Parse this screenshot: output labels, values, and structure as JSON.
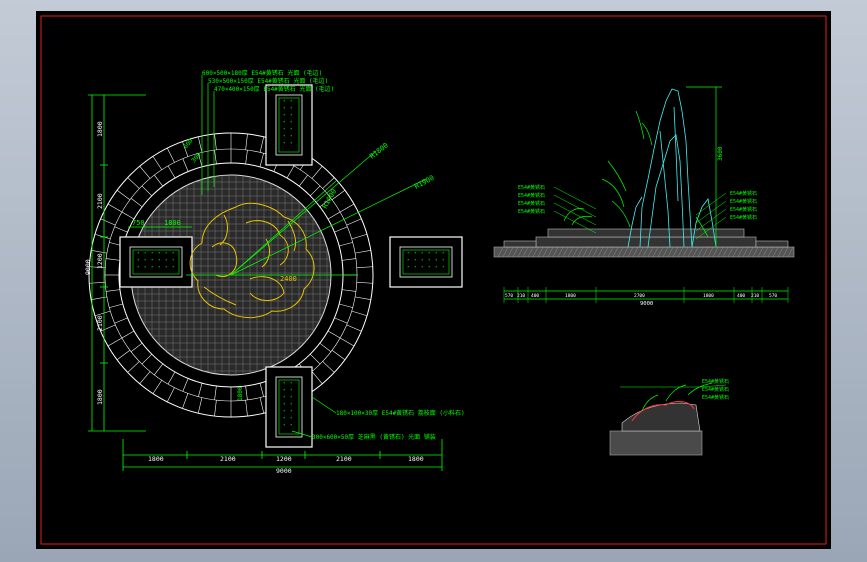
{
  "plan": {
    "top_dims": [
      "1800",
      "2100",
      "1200",
      "2100",
      "1800"
    ],
    "left_dims": [
      "1800",
      "2100",
      "1200",
      "2100",
      "1800"
    ],
    "overall_bottom": "9000",
    "overall_left": "9000",
    "center_dim": "2400",
    "radius_outer": "R1800",
    "radius_mid": "R1000",
    "radius_inner": "R1900",
    "small_dims": {
      "a": "750",
      "b": "1800",
      "c": "1800",
      "d": "600",
      "e": "300"
    },
    "notes": [
      "600×500×180厚 E54#黄锈石 光面 (毛边)",
      "530×500×150厚 E54#黄锈石 光面 (毛边)",
      "470×400×150厚 E54#黄锈石 光面 (毛边)",
      "180×100×30厚 E54#黄锈石 荔枝面 (小料石)",
      "300×600×50厚 芝麻黑 (黄锈石) 光面 铺装"
    ]
  },
  "elevation": {
    "dims": [
      "570",
      "210",
      "400",
      "1800",
      "2700",
      "1800",
      "400",
      "210",
      "570"
    ],
    "total": "9000",
    "height": "3600",
    "labels": [
      "E54#黄锈石",
      "E54#黄锈石",
      "E54#黄锈石",
      "E54#黄锈石",
      "E54#黄锈石",
      "E54#黄锈石",
      "E54#黄锈石",
      "E54#黄锈石"
    ]
  },
  "detail": {
    "labels": [
      "E54#黄锈石",
      "E54#黄锈石",
      "E54#黄锈石"
    ]
  },
  "colors": {
    "green": "#00ff00",
    "yellow": "#e8c100",
    "white": "#ffffff",
    "red": "#ff2020",
    "cyan": "#3ff0f0",
    "grey": "#9a9a9a"
  }
}
